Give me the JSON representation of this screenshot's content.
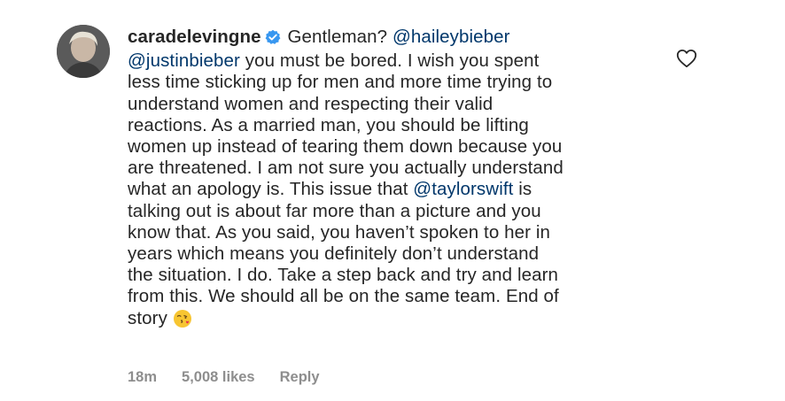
{
  "comment": {
    "username": "caradelevingne",
    "verified_icon": "verified-badge-icon",
    "mentions": [
      "@haileybieber",
      "@justinbieber",
      "@taylorswift"
    ],
    "lines": {
      "l1_text": " Gentleman? ",
      "l1_mention": "@haileybieber",
      "l2_mention": "@justinbieber",
      "l2_text": " you must be bored. I wish you spent",
      "l3": "less time sticking up for men and more time trying to",
      "l4": "understand women and respecting their valid",
      "l5": "reactions. As a married man, you should be lifting",
      "l6": "women up instead of tearing them down because you",
      "l7": "are threatened. I am not sure you actually understand",
      "l8": "what an apology is. This issue that ",
      "l8_mention": "@taylorswift",
      "l8_after": " is",
      "l9": "talking out is about far more than a picture and you",
      "l10": "know that. As you said, you haven’t spoken to her in",
      "l11": "years which means you definitely don’t understand",
      "l12": "the situation. I do. Take a step back and try and learn",
      "l13": "from this. We should all be on the same team. End of",
      "l14": "story"
    },
    "emoji": "face-blowing-kiss-emoji",
    "time": "18m",
    "likes": "5,008 likes",
    "reply_label": "Reply",
    "like_icon": "heart-outline-icon"
  },
  "colors": {
    "text": "#262626",
    "mention": "#00376b",
    "meta": "#8e8e8e",
    "verified": "#3897f0"
  }
}
